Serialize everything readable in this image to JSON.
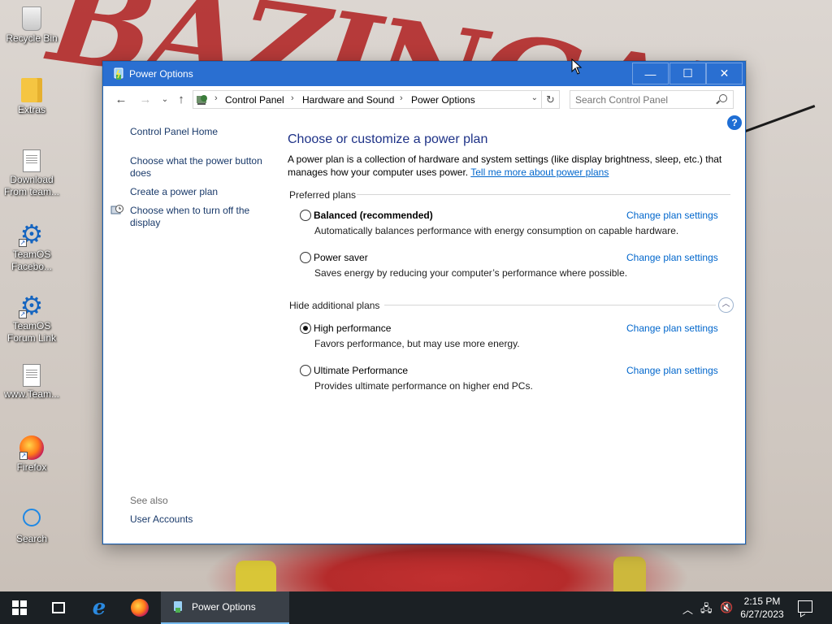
{
  "desktop": {
    "icons": [
      {
        "label": "Recycle Bin",
        "icon": "recycle-bin-icon"
      },
      {
        "label": "Extras",
        "icon": "folder-icon"
      },
      {
        "label": "Download From team...",
        "label_line1": "Download",
        "label_line2": "From team...",
        "icon": "document-icon"
      },
      {
        "label_line1": "TeamOS",
        "label_line2": "Facebo...",
        "icon": "gear-shortcut-icon"
      },
      {
        "label_line1": "TeamOS",
        "label_line2": "Forum Link",
        "icon": "gear-shortcut-icon"
      },
      {
        "label": "www.Team...",
        "icon": "document-icon"
      },
      {
        "label": "Firefox",
        "icon": "firefox-icon"
      },
      {
        "label": "Search",
        "icon": "search-circle-icon"
      }
    ]
  },
  "window": {
    "title": "Power Options",
    "controls": {
      "minimize": "—",
      "maximize": "☐",
      "close": "✕"
    }
  },
  "address_bar": {
    "breadcrumbs": [
      "Control Panel",
      "Hardware and Sound",
      "Power Options"
    ],
    "search_placeholder": "Search Control Panel"
  },
  "left_nav": {
    "home": "Control Panel Home",
    "links": [
      "Choose what the power button does",
      "Create a power plan",
      "Choose when to turn off the display"
    ],
    "see_also_label": "See also",
    "see_also_links": [
      "User Accounts"
    ]
  },
  "main": {
    "heading": "Choose or customize a power plan",
    "description": "A power plan is a collection of hardware and system settings (like display brightness, sleep, etc.) that manages how your computer uses power.",
    "learn_more_link": "Tell me more about power plans",
    "preferred_header": "Preferred plans",
    "additional_header": "Hide additional plans",
    "change_link_label": "Change plan settings",
    "preferred_plans": [
      {
        "name": "Balanced (recommended)",
        "description": "Automatically balances performance with energy consumption on capable hardware.",
        "selected": false
      },
      {
        "name": "Power saver",
        "description": "Saves energy by reducing your computer’s performance where possible.",
        "selected": false
      }
    ],
    "additional_plans": [
      {
        "name": "High performance",
        "description": "Favors performance, but may use more energy.",
        "selected": true
      },
      {
        "name": "Ultimate Performance",
        "description": "Provides ultimate performance on higher end PCs.",
        "selected": false
      }
    ]
  },
  "taskbar": {
    "active_task": "Power Options",
    "time": "2:15 PM",
    "date": "6/27/2023"
  },
  "colors": {
    "titlebar": "#2a6fd1",
    "link": "#0066cc",
    "heading": "#1e3287",
    "taskbar": "#1b2024"
  }
}
